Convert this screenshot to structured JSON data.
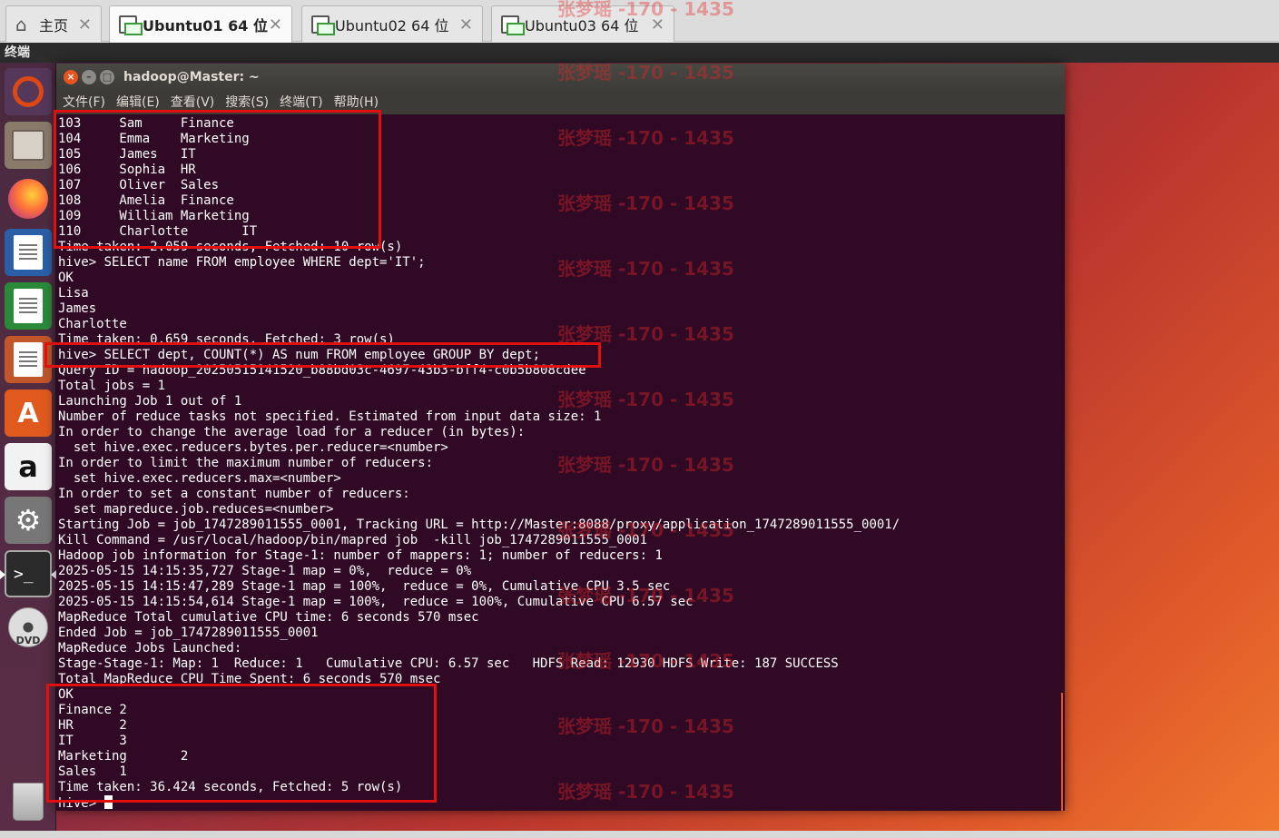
{
  "host": {
    "tabs": [
      {
        "label": "主页",
        "icon": "home-icon",
        "active": false
      },
      {
        "label": "Ubuntu01 64 位",
        "icon": "vm-icon",
        "active": true
      },
      {
        "label": "Ubuntu02 64 位",
        "icon": "vm-icon",
        "active": false
      },
      {
        "label": "Ubuntu03 64 位",
        "icon": "vm-icon",
        "active": false
      }
    ],
    "close_glyph": "✕",
    "subbar_label": "终端"
  },
  "launcher": {
    "amazon_glyph": "a",
    "store_glyph": "A",
    "terminal_glyph": ">_",
    "dvd_label": "DVD"
  },
  "window": {
    "title": "hadoop@Master: ~",
    "menu": [
      "文件(F)",
      "编辑(E)",
      "查看(V)",
      "搜索(S)",
      "终端(T)",
      "帮助(H)"
    ]
  },
  "terminal": {
    "lines": [
      "103     Sam     Finance",
      "104     Emma    Marketing",
      "105     James   IT",
      "106     Sophia  HR",
      "107     Oliver  Sales",
      "108     Amelia  Finance",
      "109     William Marketing",
      "110     Charlotte       IT",
      "Time taken: 2.059 seconds, Fetched: 10 row(s)",
      "hive> SELECT name FROM employee WHERE dept='IT';",
      "OK",
      "Lisa",
      "James",
      "Charlotte",
      "Time taken: 0.659 seconds, Fetched: 3 row(s)",
      "hive> SELECT dept, COUNT(*) AS num FROM employee GROUP BY dept;",
      "Query ID = hadoop_20250515141520_b88bd03c-4697-43b3-bff4-c0b5b808cdee",
      "Total jobs = 1",
      "Launching Job 1 out of 1",
      "Number of reduce tasks not specified. Estimated from input data size: 1",
      "In order to change the average load for a reducer (in bytes):",
      "  set hive.exec.reducers.bytes.per.reducer=<number>",
      "In order to limit the maximum number of reducers:",
      "  set hive.exec.reducers.max=<number>",
      "In order to set a constant number of reducers:",
      "  set mapreduce.job.reduces=<number>",
      "Starting Job = job_1747289011555_0001, Tracking URL = http://Master:8088/proxy/application_1747289011555_0001/",
      "Kill Command = /usr/local/hadoop/bin/mapred job  -kill job_1747289011555_0001",
      "Hadoop job information for Stage-1: number of mappers: 1; number of reducers: 1",
      "2025-05-15 14:15:35,727 Stage-1 map = 0%,  reduce = 0%",
      "2025-05-15 14:15:47,289 Stage-1 map = 100%,  reduce = 0%, Cumulative CPU 3.5 sec",
      "2025-05-15 14:15:54,614 Stage-1 map = 100%,  reduce = 100%, Cumulative CPU 6.57 sec",
      "MapReduce Total cumulative CPU time: 6 seconds 570 msec",
      "Ended Job = job_1747289011555_0001",
      "MapReduce Jobs Launched:",
      "Stage-Stage-1: Map: 1  Reduce: 1   Cumulative CPU: 6.57 sec   HDFS Read: 12930 HDFS Write: 187 SUCCESS",
      "Total MapReduce CPU Time Spent: 6 seconds 570 msec",
      "OK",
      "Finance 2",
      "HR      2",
      "IT      3",
      "Marketing       2",
      "Sales   1",
      "Time taken: 36.424 seconds, Fetched: 5 row(s)"
    ],
    "prompt": "hive> "
  },
  "watermark": {
    "text": "张梦瑶 -170 - 1435",
    "color": "#e82828"
  },
  "colors": {
    "terminal_bg": "#300a24",
    "highlight_box": "#e01010"
  }
}
